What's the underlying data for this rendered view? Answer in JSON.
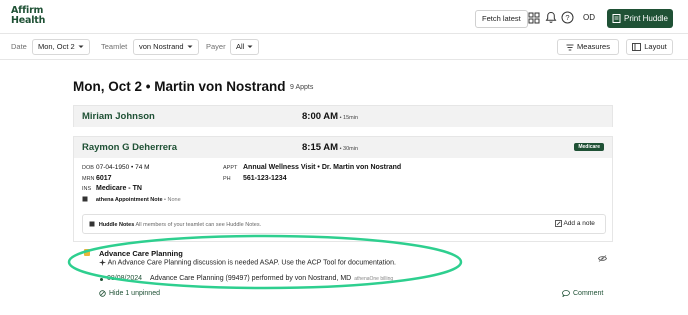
{
  "brand": {
    "line1": "Affirm",
    "line2": "Health",
    "color": "#1f5135"
  },
  "topbar": {
    "fetch_label": "Fetch latest",
    "icons": [
      "grid-icon",
      "bell-icon",
      "help-icon"
    ],
    "avatar_initials": "OD",
    "print_label": "Print Huddle"
  },
  "filters": {
    "date_label": "Date",
    "date_value": "Mon, Oct 2",
    "teamlet_label": "Teamlet",
    "teamlet_value": "von Nostrand",
    "payer_label": "Payer",
    "payer_value": "All",
    "measures_label": "Measures",
    "layout_label": "Layout"
  },
  "page": {
    "title": "Mon, Oct 2 • Martin von Nostrand",
    "appt_count": "9 Appts"
  },
  "appointments": [
    {
      "name": "Miriam Johnson",
      "time": "8:00 AM",
      "duration": " • 15min"
    },
    {
      "name": "Raymon G Deherrera",
      "time": "8:15 AM",
      "duration": " • 30min",
      "badge": "Medicare",
      "dob_key": "DOB",
      "dob": "07-04-1950 • 74 M",
      "mrn_key": "MRN",
      "mrn": "6017",
      "ins_key": "INS",
      "ins": "Medicare - TN",
      "appt_key": "APPT",
      "appt": "Annual Wellness Visit • Dr. Martin von Nostrand",
      "ph_key": "PH",
      "ph": "561-123-1234",
      "athena_note_label": "athena Appointment Note",
      "athena_note_value": " • None",
      "huddle_notes_label": "Huddle Notes",
      "huddle_notes_hint": " All members of your teamlet can see Huddle Notes.",
      "add_note_label": "Add a note",
      "acp": {
        "title": "Advance Care Planning",
        "message": "An Advance Care Planning discussion is needed ASAP. Use the ACP Tool for documentation.",
        "date": "08/08/2024",
        "record": "Advance Care Planning (99497) performed by von Nostrand, MD",
        "record_meta": "athenaOne billing",
        "hide_label": "Hide 1 unpinned",
        "comment_label": "Comment"
      }
    }
  ],
  "annotation_color": "#2ecf8f"
}
